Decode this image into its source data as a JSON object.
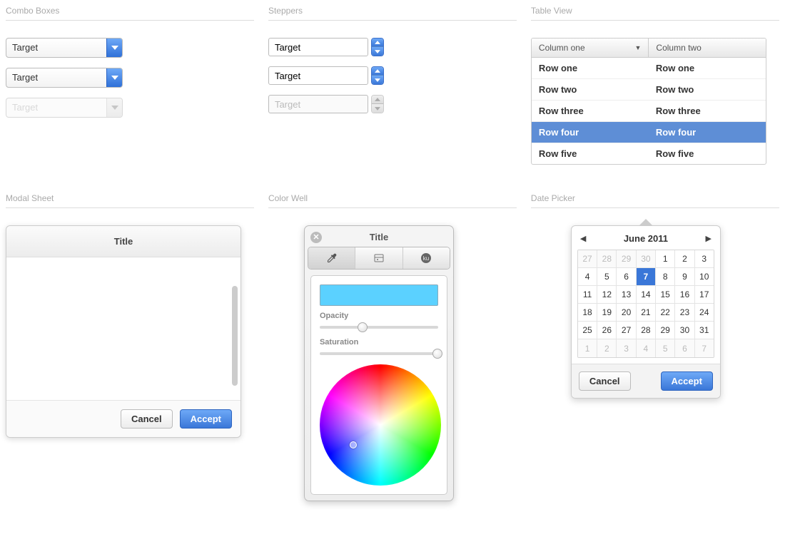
{
  "sections": {
    "combo": "Combo Boxes",
    "steppers": "Steppers",
    "table": "Table View",
    "modal": "Modal Sheet",
    "colorwell": "Color Well",
    "datepicker": "Date Picker"
  },
  "combo": {
    "value1": "Target",
    "value2": "Target",
    "value3": "Target"
  },
  "stepper": {
    "value1": "Target",
    "value2": "Target",
    "value3": "Target"
  },
  "table": {
    "col1": "Column one",
    "col2": "Column two",
    "rows": [
      {
        "c1": "Row one",
        "c2": "Row one",
        "selected": false
      },
      {
        "c1": "Row two",
        "c2": "Row two",
        "selected": false
      },
      {
        "c1": "Row three",
        "c2": "Row three",
        "selected": false
      },
      {
        "c1": "Row four",
        "c2": "Row four",
        "selected": true
      },
      {
        "c1": "Row five",
        "c2": "Row five",
        "selected": false
      }
    ]
  },
  "modal": {
    "title": "Title",
    "cancel": "Cancel",
    "accept": "Accept"
  },
  "colorwell": {
    "title": "Title",
    "swatch_color": "#5bd1ff",
    "opacity_label": "Opacity",
    "opacity_value": 32,
    "saturation_label": "Saturation",
    "saturation_value": 95
  },
  "datepicker": {
    "month_label": "June 2011",
    "selected_day": 7,
    "weeks": [
      [
        {
          "d": 27,
          "m": true
        },
        {
          "d": 28,
          "m": true
        },
        {
          "d": 29,
          "m": true
        },
        {
          "d": 30,
          "m": true
        },
        {
          "d": 1
        },
        {
          "d": 2
        },
        {
          "d": 3
        }
      ],
      [
        {
          "d": 4
        },
        {
          "d": 5
        },
        {
          "d": 6
        },
        {
          "d": 7,
          "sel": true
        },
        {
          "d": 8
        },
        {
          "d": 9
        },
        {
          "d": 10
        }
      ],
      [
        {
          "d": 11
        },
        {
          "d": 12
        },
        {
          "d": 13
        },
        {
          "d": 14
        },
        {
          "d": 15
        },
        {
          "d": 16
        },
        {
          "d": 17
        }
      ],
      [
        {
          "d": 18
        },
        {
          "d": 19
        },
        {
          "d": 20
        },
        {
          "d": 21
        },
        {
          "d": 22
        },
        {
          "d": 23
        },
        {
          "d": 24
        }
      ],
      [
        {
          "d": 25
        },
        {
          "d": 26
        },
        {
          "d": 27
        },
        {
          "d": 28
        },
        {
          "d": 29
        },
        {
          "d": 30
        },
        {
          "d": 31
        }
      ],
      [
        {
          "d": 1,
          "m": true
        },
        {
          "d": 2,
          "m": true
        },
        {
          "d": 3,
          "m": true
        },
        {
          "d": 4,
          "m": true
        },
        {
          "d": 5,
          "m": true
        },
        {
          "d": 6,
          "m": true
        },
        {
          "d": 7,
          "m": true
        }
      ]
    ],
    "cancel": "Cancel",
    "accept": "Accept"
  }
}
